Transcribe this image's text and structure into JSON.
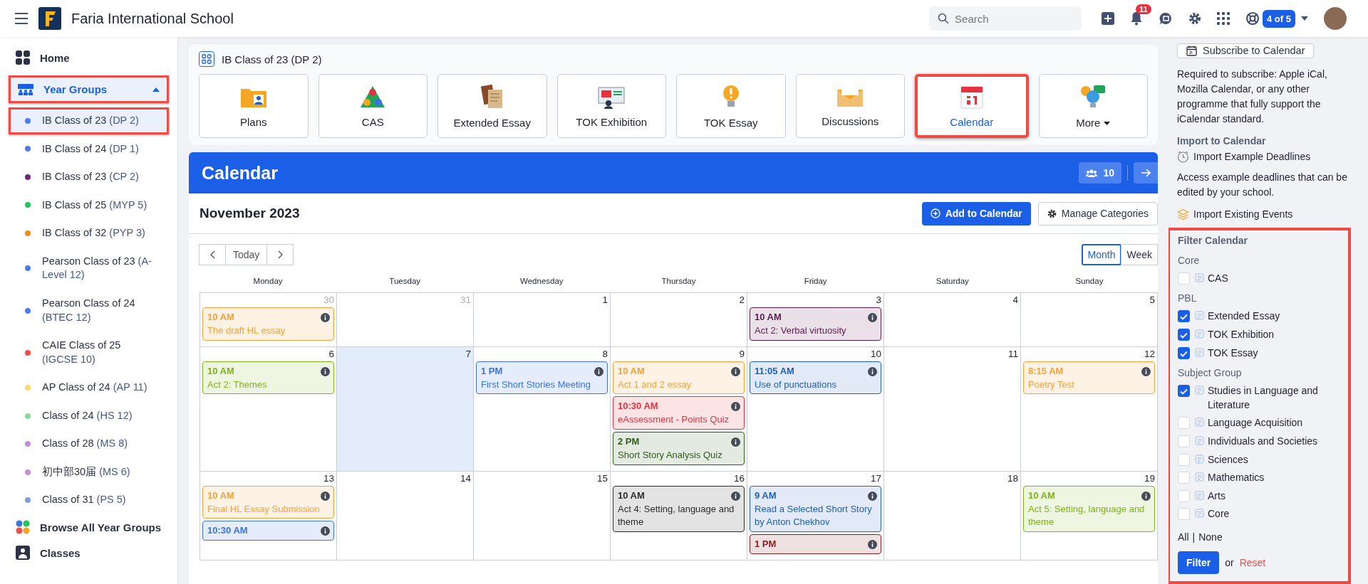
{
  "header": {
    "school": "Faria International School",
    "search": {
      "placeholder": "Search"
    },
    "notifications": "11",
    "account_switch": "4 of 5"
  },
  "sidebar": {
    "home": "Home",
    "year_groups": {
      "label": "Year Groups",
      "expanded": true,
      "highlighted": true
    },
    "items": [
      {
        "name": "IB Class of 23",
        "code": "(DP 2)",
        "color": "#4a7cf0",
        "selected": true,
        "highlighted": true
      },
      {
        "name": "IB Class of 24",
        "code": "(DP 1)",
        "color": "#4a7cf0",
        "selected": false,
        "highlighted": false
      },
      {
        "name": "IB Class of 23",
        "code": "(CP 2)",
        "color": "#6b2a7a",
        "selected": false,
        "highlighted": false
      },
      {
        "name": "IB Class of 25",
        "code": "(MYP 5)",
        "color": "#22c55e",
        "selected": false,
        "highlighted": false
      },
      {
        "name": "IB Class of 32",
        "code": "(PYP 3)",
        "color": "#f08c1e",
        "selected": false,
        "highlighted": false
      },
      {
        "name": "Pearson Class of 23",
        "code": "(A-Level 12)",
        "color": "#4a7cf0",
        "selected": false,
        "highlighted": false
      },
      {
        "name": "Pearson Class of 24",
        "code": "(BTEC 12)",
        "color": "#4a7cf0",
        "selected": false,
        "highlighted": false
      },
      {
        "name": "CAIE Class of 25",
        "code": "(IGCSE 10)",
        "color": "#f0504a",
        "selected": false,
        "highlighted": false
      },
      {
        "name": "AP Class of 24",
        "code": "(AP 11)",
        "color": "#fcd970",
        "selected": false,
        "highlighted": false
      },
      {
        "name": "Class of 24",
        "code": "(HS 12)",
        "color": "#86d9a0",
        "selected": false,
        "highlighted": false
      },
      {
        "name": "Class of 28",
        "code": "(MS 8)",
        "color": "#c58fd6",
        "selected": false,
        "highlighted": false
      },
      {
        "name": "初中部30届",
        "code": "(MS 6)",
        "color": "#c58fd6",
        "selected": false,
        "highlighted": false
      },
      {
        "name": "Class of 31",
        "code": "(PS 5)",
        "color": "#7f9fd6",
        "selected": false,
        "highlighted": false
      }
    ],
    "browse": "Browse All Year Groups",
    "classes": "Classes"
  },
  "group_title": "IB Class of 23 (DP 2)",
  "tiles": [
    {
      "label": "Plans",
      "selected": false,
      "highlighted": false
    },
    {
      "label": "CAS",
      "selected": false,
      "highlighted": false
    },
    {
      "label": "Extended Essay",
      "selected": false,
      "highlighted": false
    },
    {
      "label": "TOK Exhibition",
      "selected": false,
      "highlighted": false
    },
    {
      "label": "TOK Essay",
      "selected": false,
      "highlighted": false
    },
    {
      "label": "Discussions",
      "selected": false,
      "highlighted": false
    },
    {
      "label": "Calendar",
      "selected": true,
      "highlighted": true
    },
    {
      "label": "More",
      "selected": false,
      "highlighted": false,
      "dropdown": true
    }
  ],
  "calendar": {
    "title": "Calendar",
    "members": "10",
    "month": "November 2023",
    "add": "Add to Calendar",
    "manage": "Manage Categories",
    "today": "Today",
    "views": [
      {
        "label": "Month",
        "selected": true
      },
      {
        "label": "Week",
        "selected": false
      }
    ],
    "weekdays": [
      "Monday",
      "Tuesday",
      "Wednesday",
      "Thursday",
      "Friday",
      "Saturday",
      "Sunday"
    ],
    "weeks": [
      {
        "days": [
          {
            "date": "30",
            "muted": true,
            "today": false,
            "events": [
              {
                "time": "10 AM",
                "title": "The draft HL essay",
                "color": "#f7a13a"
              }
            ]
          },
          {
            "date": "31",
            "muted": true,
            "today": false
          },
          {
            "date": "1",
            "muted": false,
            "today": false
          },
          {
            "date": "2",
            "muted": false,
            "today": false
          },
          {
            "date": "3",
            "muted": false,
            "today": false,
            "events": [
              {
                "time": "10 AM",
                "title": "Act 2: Verbal virtuosity",
                "color": "#5b1b4e"
              }
            ]
          },
          {
            "date": "4",
            "muted": false,
            "today": false
          },
          {
            "date": "5",
            "muted": false,
            "today": false
          }
        ]
      },
      {
        "days": [
          {
            "date": "6",
            "muted": false,
            "today": false,
            "events": [
              {
                "time": "10 AM",
                "title": "Act 2: Themes",
                "color": "#7cb518"
              }
            ]
          },
          {
            "date": "7",
            "muted": false,
            "today": true
          },
          {
            "date": "8",
            "muted": false,
            "today": false,
            "events": [
              {
                "time": "1 PM",
                "title": "First Short Stories Meeting",
                "color": "#3b73e0"
              }
            ]
          },
          {
            "date": "9",
            "muted": false,
            "today": false,
            "events": [
              {
                "time": "10 AM",
                "title": "Act 1 and 2 essay",
                "color": "#f7a13a"
              },
              {
                "time": "10:30 AM",
                "title": "eAssessment - Points Quiz",
                "color": "#e5323e"
              },
              {
                "time": "2 PM",
                "title": "Short Story Analysis Quiz",
                "color": "#2c5e1a"
              }
            ]
          },
          {
            "date": "10",
            "muted": false,
            "today": false,
            "events": [
              {
                "time": "11:05 AM",
                "title": "Use of punctuations",
                "color": "#1f5fb8"
              }
            ]
          },
          {
            "date": "11",
            "muted": false,
            "today": false
          },
          {
            "date": "12",
            "muted": false,
            "today": false,
            "events": [
              {
                "time": "8:15 AM",
                "title": "Poetry Test",
                "color": "#f7a13a"
              }
            ]
          }
        ]
      },
      {
        "days": [
          {
            "date": "13",
            "muted": false,
            "today": false,
            "events": [
              {
                "time": "10 AM",
                "title": "Final HL Essay Submission",
                "color": "#f7a13a"
              },
              {
                "time": "10:30 AM",
                "color": "#3b73e0"
              }
            ]
          },
          {
            "date": "14",
            "muted": false,
            "today": false
          },
          {
            "date": "15",
            "muted": false,
            "today": false
          },
          {
            "date": "16",
            "muted": false,
            "today": false,
            "events": [
              {
                "time": "10 AM",
                "title": "Act 4: Setting, language and theme",
                "color": "#2b2b2b"
              }
            ]
          },
          {
            "date": "17",
            "muted": false,
            "today": false,
            "events": [
              {
                "time": "9 AM",
                "title": "Read a Selected Short Story by Anton Chekhov",
                "color": "#1f5fb8"
              },
              {
                "time": "1 PM",
                "color": "#8a1c1c"
              }
            ]
          },
          {
            "date": "18",
            "muted": false,
            "today": false
          },
          {
            "date": "19",
            "muted": false,
            "today": false,
            "events": [
              {
                "time": "10 AM",
                "title": "Act 5: Setting, language and theme",
                "color": "#7cb518"
              }
            ]
          }
        ]
      }
    ]
  },
  "side": {
    "subscribe": "Subscribe to Calendar",
    "subscribe_note": "Required to subscribe: Apple iCal, Mozilla Calendar, or any other programme that fully support the iCalendar standard.",
    "import_title": "Import to Calendar",
    "import_example": "Import Example Deadlines",
    "import_note": "Access example deadlines that can be edited by your school.",
    "import_existing": "Import Existing Events",
    "filter": {
      "title": "Filter Calendar",
      "highlighted": true,
      "groups": [
        {
          "name": "Core",
          "items": [
            {
              "label": "CAS",
              "checked": false
            }
          ]
        },
        {
          "name": "PBL",
          "items": [
            {
              "label": "Extended Essay",
              "checked": true
            },
            {
              "label": "TOK Exhibition",
              "checked": true
            },
            {
              "label": "TOK Essay",
              "checked": true
            }
          ]
        },
        {
          "name": "Subject Group",
          "items": [
            {
              "label": "Studies in Language and Literature",
              "checked": true
            },
            {
              "label": "Language Acquisition",
              "checked": false
            },
            {
              "label": "Individuals and Societies",
              "checked": false
            },
            {
              "label": "Sciences",
              "checked": false
            },
            {
              "label": "Mathematics",
              "checked": false
            },
            {
              "label": "Arts",
              "checked": false
            },
            {
              "label": "Core",
              "checked": false
            }
          ]
        }
      ],
      "all": "All",
      "separator": "|",
      "none": "None",
      "apply": "Filter",
      "or": "or",
      "reset": "Reset"
    }
  }
}
